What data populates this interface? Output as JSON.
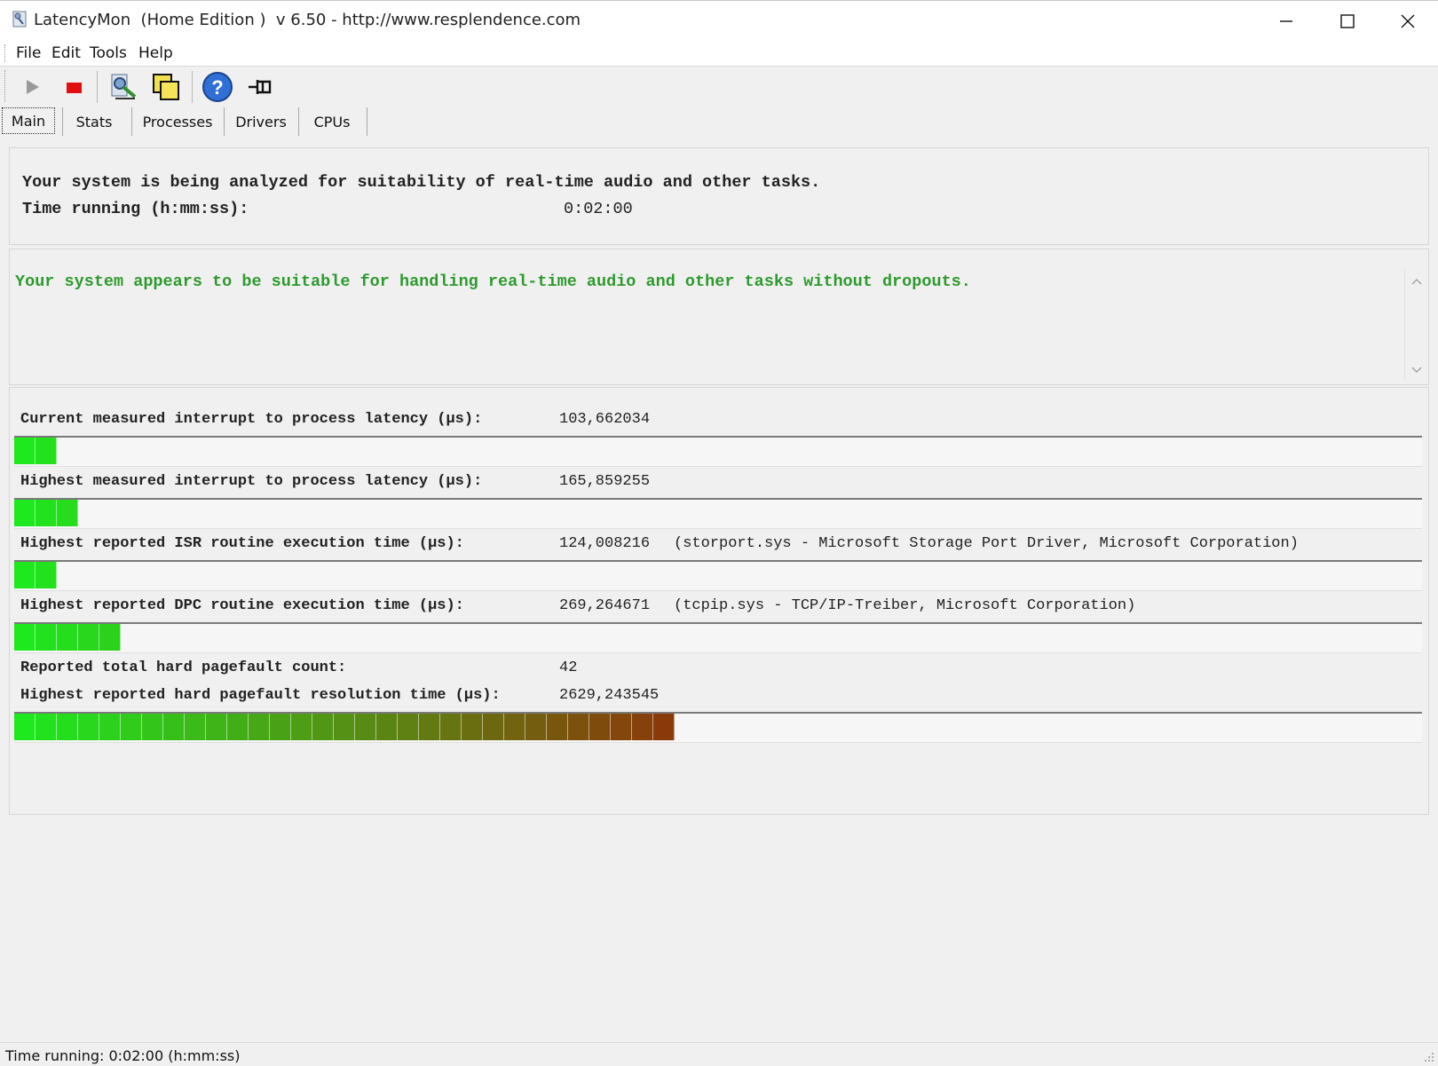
{
  "window": {
    "title": "LatencyMon  (Home Edition )  v 6.50 - http://www.resplendence.com"
  },
  "menu": {
    "file": "File",
    "edit": "Edit",
    "tools": "Tools",
    "help": "Help"
  },
  "toolbar": {
    "icons": [
      "play-icon",
      "stop-icon",
      "search-tool-icon",
      "windows-icon",
      "help-icon",
      "pin-icon"
    ]
  },
  "tabs": [
    {
      "label": "Main",
      "active": true
    },
    {
      "label": "Stats",
      "active": false
    },
    {
      "label": "Processes",
      "active": false
    },
    {
      "label": "Drivers",
      "active": false
    },
    {
      "label": "CPUs",
      "active": false
    }
  ],
  "analysis": {
    "status_line": "Your system is being analyzed for suitability of real-time audio and other tasks.",
    "time_label": "Time running (h:mm:ss):",
    "time_value": "0:02:00"
  },
  "verdict": {
    "text": "Your system appears to be suitable for handling real-time audio and other tasks without dropouts.",
    "color": "#2e9a2e"
  },
  "metrics": {
    "current_latency": {
      "label": "Current measured interrupt to process latency (µs):",
      "value": "103,662034",
      "segments": 2
    },
    "highest_latency": {
      "label": "Highest measured interrupt to process latency (µs):",
      "value": "165,859255",
      "segments": 3
    },
    "isr": {
      "label": "Highest reported ISR routine execution time (µs):",
      "value": "124,008216",
      "extra": "(storport.sys - Microsoft Storage Port Driver, Microsoft Corporation)",
      "segments": 2
    },
    "dpc": {
      "label": "Highest reported DPC routine execution time (µs):",
      "value": "269,264671",
      "extra": "(tcpip.sys - TCP/IP-Treiber, Microsoft Corporation)",
      "segments": 5
    },
    "pagefault_count": {
      "label": "Reported total hard pagefault count:",
      "value": "42"
    },
    "pagefault_time": {
      "label": "Highest reported hard pagefault resolution time (µs):",
      "value": "2629,243545",
      "segments": 31
    }
  },
  "colors": {
    "bar_start": "#1ee81e",
    "bar_end": "#8a3a0a"
  },
  "status": {
    "text": "Time running: 0:02:00  (h:mm:ss)"
  }
}
